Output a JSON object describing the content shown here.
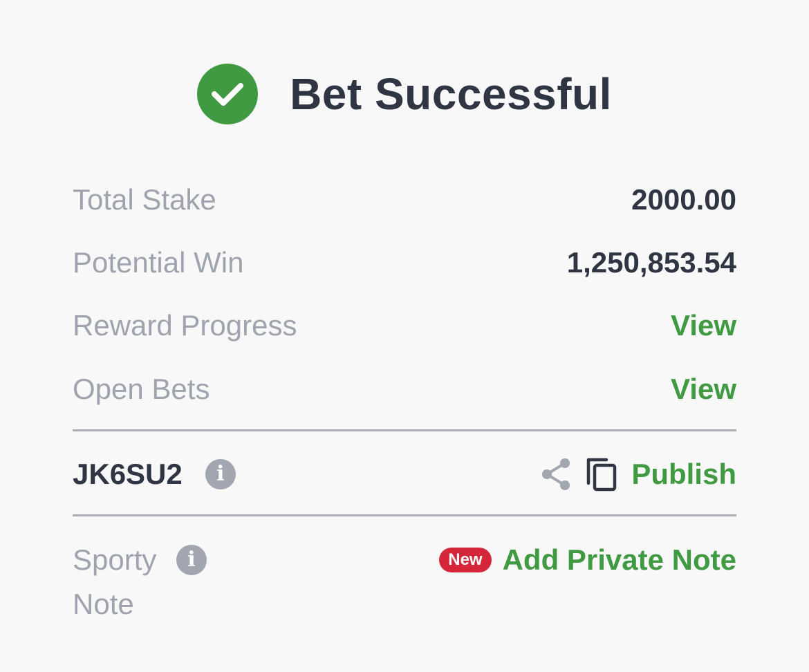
{
  "header": {
    "icon": "check-circle-icon",
    "title": "Bet Successful",
    "accent_color": "#3f9a41"
  },
  "summary": {
    "total_stake_label": "Total Stake",
    "total_stake_value": "2000.00",
    "potential_win_label": "Potential Win",
    "potential_win_value": "1,250,853.54",
    "reward_progress_label": "Reward Progress",
    "reward_progress_link": "View",
    "open_bets_label": "Open Bets",
    "open_bets_link": "View"
  },
  "booking": {
    "code": "JK6SU2",
    "info_icon": "info-icon",
    "share_icon": "share-icon",
    "copy_icon": "copy-icon",
    "publish_label": "Publish"
  },
  "note": {
    "label_line1": "Sporty",
    "label_line2": "Note",
    "info_icon": "info-icon",
    "badge": "New",
    "badge_color": "#d5263a",
    "add_label": "Add Private Note"
  }
}
